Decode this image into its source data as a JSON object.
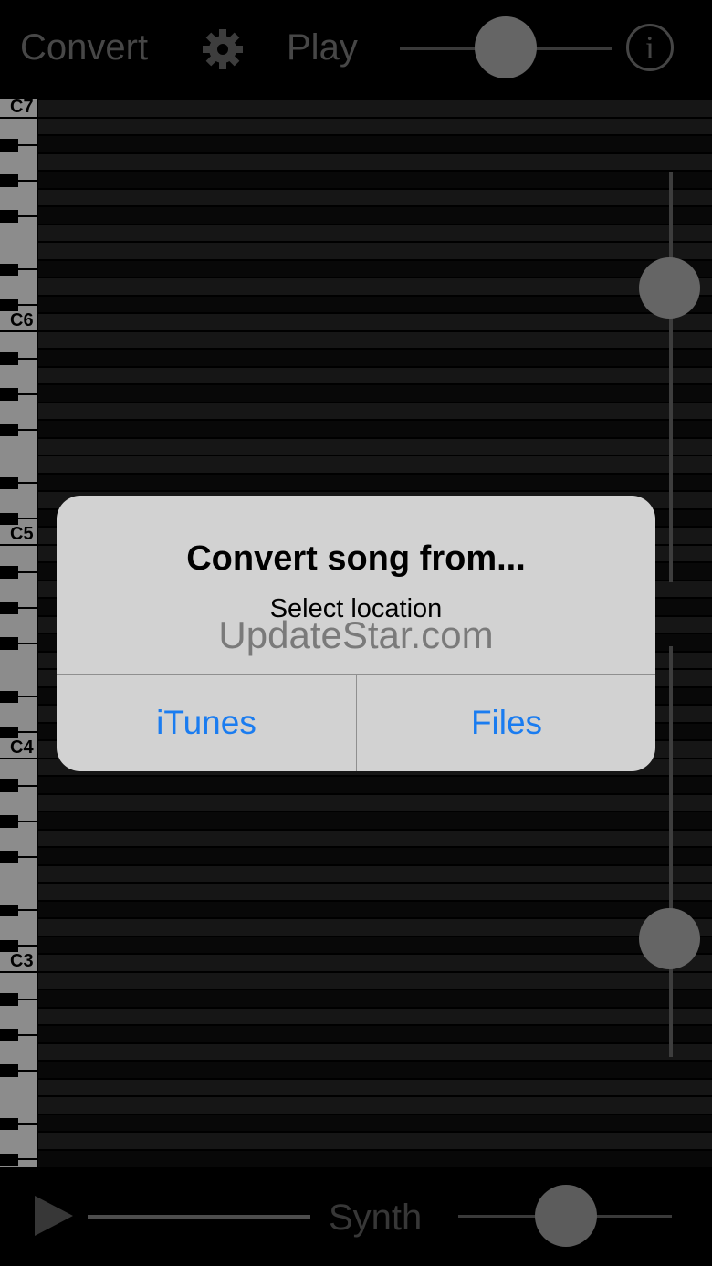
{
  "topbar": {
    "convert_label": "Convert",
    "settings_icon": "gear-icon",
    "play_label": "Play",
    "speed_slider_value": 0.5,
    "info_glyph": "i"
  },
  "piano": {
    "octave_labels": [
      "C7",
      "C6",
      "C5",
      "C4",
      "C3"
    ]
  },
  "sliders": {
    "upper_vertical_value": 0.29,
    "lower_vertical_value": 0.33
  },
  "bottombar": {
    "play_icon": "play-icon",
    "progress_value": 1.0,
    "synth_label": "Synth",
    "volume_slider_value": 0.5
  },
  "dialog": {
    "title": "Convert song from...",
    "message": "Select location",
    "buttons": [
      "iTunes",
      "Files"
    ]
  },
  "watermark": "UpdateStar.com",
  "colors": {
    "accent": "#1a7cf0",
    "dialog_bg": "#d2d2d2",
    "knob": "#9c9c9c"
  }
}
